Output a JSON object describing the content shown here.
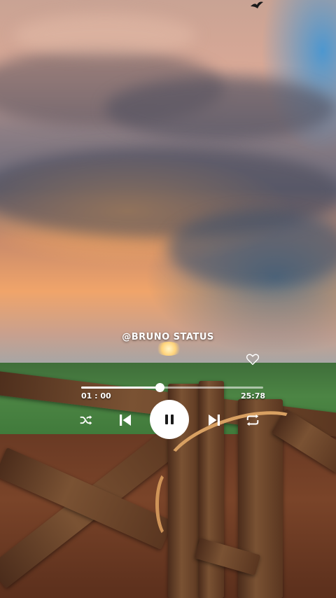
{
  "player": {
    "watermark": "@BRUNO STATUS",
    "elapsed": "01 : 00",
    "duration": "25:78",
    "progress_fraction": 0.43,
    "is_playing": true
  },
  "icons": {
    "favorite": "heart-outline-icon",
    "shuffle": "shuffle-icon",
    "previous": "skip-previous-icon",
    "pause": "pause-icon",
    "next": "skip-next-icon",
    "repeat": "repeat-icon"
  },
  "colors": {
    "controls": "#ffffff"
  }
}
